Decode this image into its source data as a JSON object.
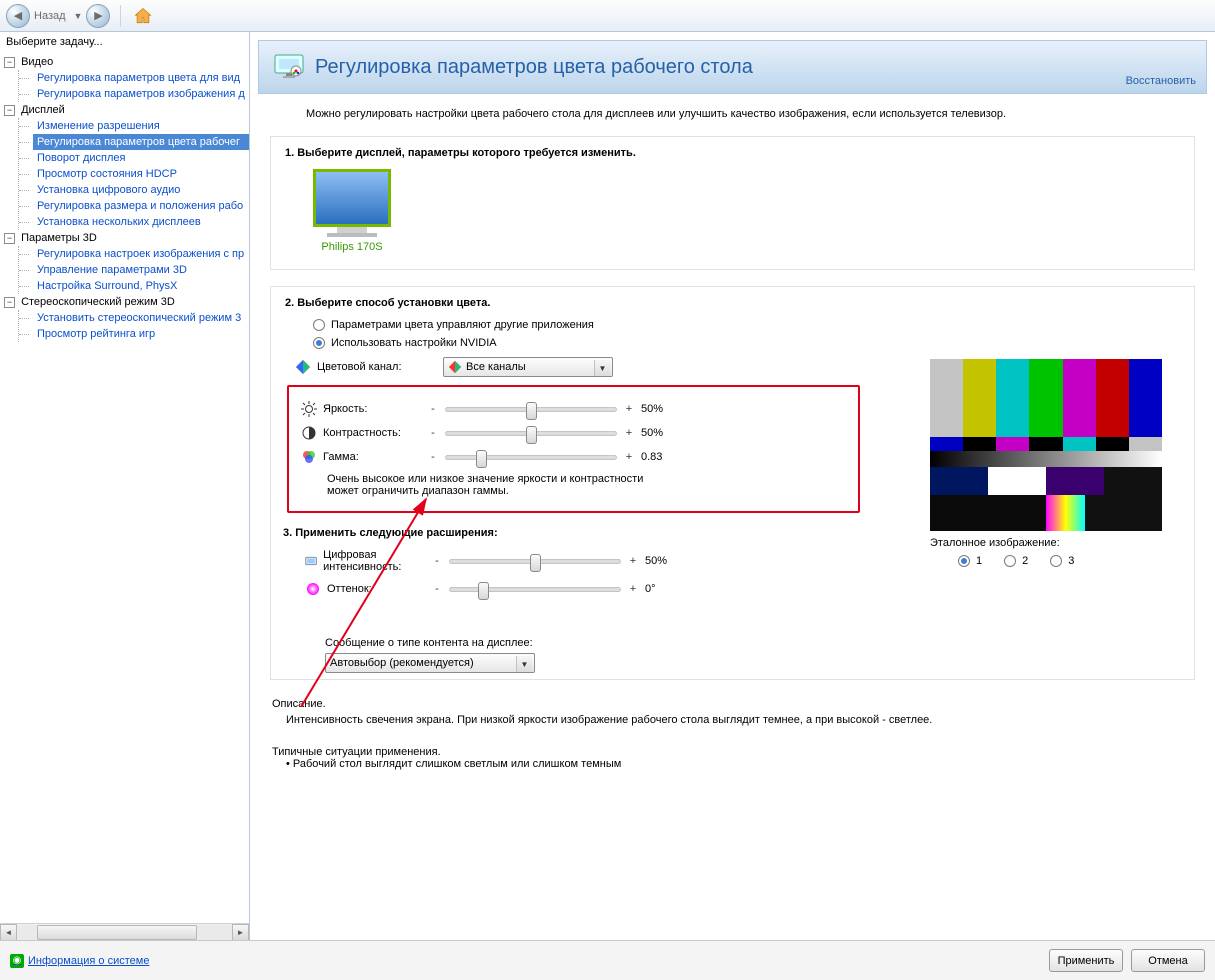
{
  "toolbar": {
    "back_label": "Назад"
  },
  "sidebar": {
    "title": "Выберите задачу...",
    "video": {
      "label": "Видео",
      "items": [
        "Регулировка параметров цвета для вид",
        "Регулировка параметров изображения д"
      ]
    },
    "display": {
      "label": "Дисплей",
      "items": [
        "Изменение разрешения",
        "Регулировка параметров цвета рабочег",
        "Поворот дисплея",
        "Просмотр состояния HDCP",
        "Установка цифрового аудио",
        "Регулировка размера и положения рабо",
        "Установка нескольких дисплеев"
      ],
      "selected_index": 1
    },
    "params3d": {
      "label": "Параметры 3D",
      "items": [
        "Регулировка настроек изображения с пр",
        "Управление параметрами 3D",
        "Настройка Surround, PhysX"
      ]
    },
    "stereo": {
      "label": "Стереоскопический режим 3D",
      "items": [
        "Установить стереоскопический режим 3",
        "Просмотр рейтинга игр"
      ]
    }
  },
  "header": {
    "title": "Регулировка параметров цвета рабочего стола",
    "restore": "Восстановить"
  },
  "intro": "Можно регулировать настройки цвета рабочего стола для дисплеев или улучшить качество изображения, если используется телевизор.",
  "step1": {
    "title": "1. Выберите дисплей, параметры которого требуется изменить.",
    "monitor": "Philips 170S"
  },
  "step2": {
    "title": "2. Выберите способ установки цвета.",
    "radio_other": "Параметрами цвета управляют другие приложения",
    "radio_nvidia": "Использовать настройки NVIDIA",
    "channel_label": "Цветовой канал:",
    "channel_value": "Все каналы",
    "brightness_label": "Яркость:",
    "brightness_value": "50%",
    "contrast_label": "Контрастность:",
    "contrast_value": "50%",
    "gamma_label": "Гамма:",
    "gamma_value": "0.83",
    "note": "Очень высокое или низкое значение яркости и контрастности может ограничить диапазон гаммы."
  },
  "step3": {
    "title": "3. Применить следующие расширения:",
    "dvib_label": "Цифровая интенсивность:",
    "dvib_value": "50%",
    "hue_label": "Оттенок:",
    "hue_value": "0°",
    "content_msg": "Сообщение о типе контента на дисплее:",
    "content_value": "Автовыбор (рекомендуется)"
  },
  "preview": {
    "label": "Эталонное изображение:",
    "opt1": "1",
    "opt2": "2",
    "opt3": "3"
  },
  "description": {
    "heading": "Описание.",
    "text": "Интенсивность свечения экрана. При низкой яркости изображение рабочего стола выглядит темнее, а при высокой - светлее."
  },
  "typical": {
    "heading": "Типичные ситуации применения.",
    "bullet1": "Рабочий стол выглядит слишком светлым или слишком темным"
  },
  "footer": {
    "sysinfo": "Информация о системе",
    "apply": "Применить",
    "cancel": "Отмена"
  }
}
